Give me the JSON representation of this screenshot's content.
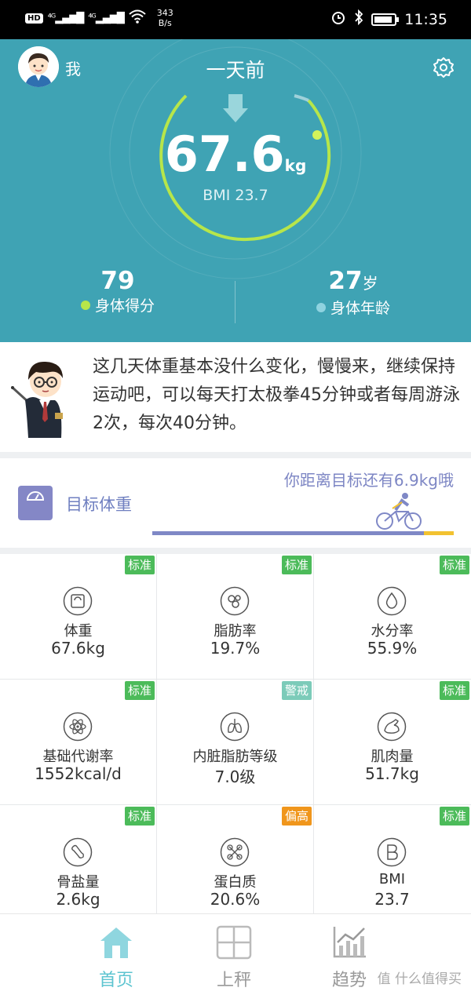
{
  "status_bar": {
    "speed_value": "343",
    "speed_unit": "B/s",
    "time": "11:35",
    "network": "4G"
  },
  "header": {
    "user_label": "我",
    "title": "一天前",
    "weight_value": "67.6",
    "weight_unit": "kg",
    "bmi_text": "BMI 23.7",
    "score_value": "79",
    "score_label": "身体得分",
    "age_value": "27",
    "age_unit": "岁",
    "age_label": "身体年龄"
  },
  "tip": {
    "text": "这几天体重基本没什么变化，慢慢来，继续保持运动吧，可以每天打太极拳45分钟或者每周游泳2次，每次40分钟。"
  },
  "goal": {
    "label": "目标体重",
    "message": "你距离目标还有6.9kg哦",
    "progress": 0.9
  },
  "metrics": [
    {
      "name": "体重",
      "value": "67.6kg",
      "badge": "标准",
      "badge_color": "#4cbb5a",
      "icon": "scale-icon"
    },
    {
      "name": "脂肪率",
      "value": "19.7%",
      "badge": "标准",
      "badge_color": "#4cbb5a",
      "icon": "fat-icon"
    },
    {
      "name": "水分率",
      "value": "55.9%",
      "badge": "标准",
      "badge_color": "#4cbb5a",
      "icon": "water-drop-icon"
    },
    {
      "name": "基础代谢率",
      "value": "1552kcal/d",
      "badge": "标准",
      "badge_color": "#4cbb5a",
      "icon": "atom-icon"
    },
    {
      "name": "内脏脂肪等级",
      "value": "7.0级",
      "badge": "警戒",
      "badge_color": "#7ccbb9",
      "icon": "lungs-icon"
    },
    {
      "name": "肌肉量",
      "value": "51.7kg",
      "badge": "标准",
      "badge_color": "#4cbb5a",
      "icon": "muscle-arm-icon"
    },
    {
      "name": "骨盐量",
      "value": "2.6kg",
      "badge": "标准",
      "badge_color": "#4cbb5a",
      "icon": "bone-icon"
    },
    {
      "name": "蛋白质",
      "value": "20.6%",
      "badge": "偏高",
      "badge_color": "#f0961c",
      "icon": "protein-icon"
    },
    {
      "name": "BMI",
      "value": "23.7",
      "badge": "标准",
      "badge_color": "#4cbb5a",
      "icon": "bmi-icon"
    }
  ],
  "tabs": [
    {
      "label": "首页",
      "icon": "home-icon",
      "active": true
    },
    {
      "label": "上秤",
      "icon": "scale-grid-icon",
      "active": false
    },
    {
      "label": "趋势",
      "icon": "trend-chart-icon",
      "active": false
    }
  ],
  "watermark": "值 什么值得买",
  "colors": {
    "header_bg": "#3fa3b4",
    "ring_green": "#b7e64a",
    "accent_blue": "#7d86c4",
    "tab_active": "#5cc4d0",
    "tab_inactive": "#999999"
  }
}
